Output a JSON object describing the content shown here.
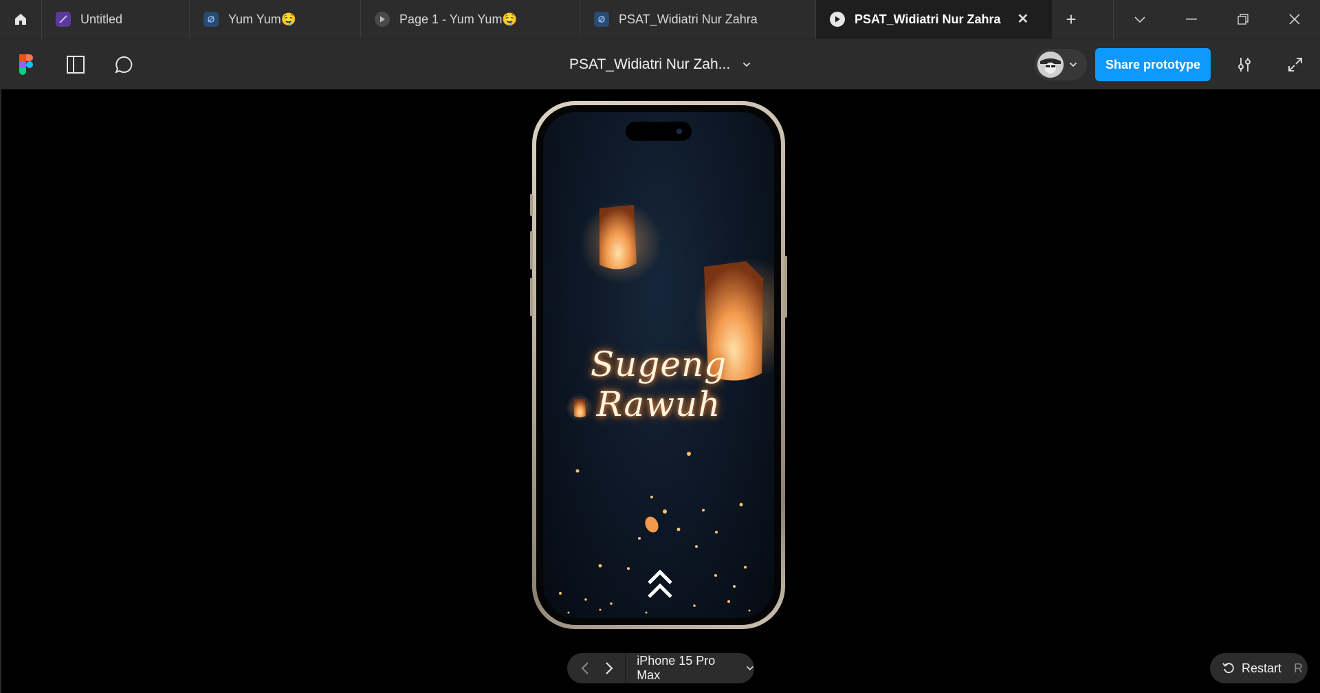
{
  "tabs": [
    {
      "label": "Untitled",
      "icon": "figma-file-purple-icon",
      "active": false
    },
    {
      "label": "Yum Yum🤤",
      "icon": "figma-file-blue-icon",
      "active": false
    },
    {
      "label": "Page 1 - Yum Yum🤤",
      "icon": "play-prototype-icon",
      "active": false
    },
    {
      "label": "PSAT_Widiatri Nur Zahra",
      "icon": "figma-file-blue-icon",
      "active": false
    },
    {
      "label": "PSAT_Widiatri Nur Zahra",
      "icon": "play-prototype-icon",
      "active": true
    }
  ],
  "toolbar": {
    "file_title": "PSAT_Widiatri Nur Zah...",
    "share_label": "Share prototype"
  },
  "prototype": {
    "greeting": "Sugeng Rawuh",
    "device_label": "iPhone 15 Pro Max"
  },
  "restart": {
    "label": "Restart",
    "shortcut": "R"
  },
  "colors": {
    "accent": "#0d99ff",
    "chrome": "#2c2c2c",
    "canvas": "#000000"
  }
}
